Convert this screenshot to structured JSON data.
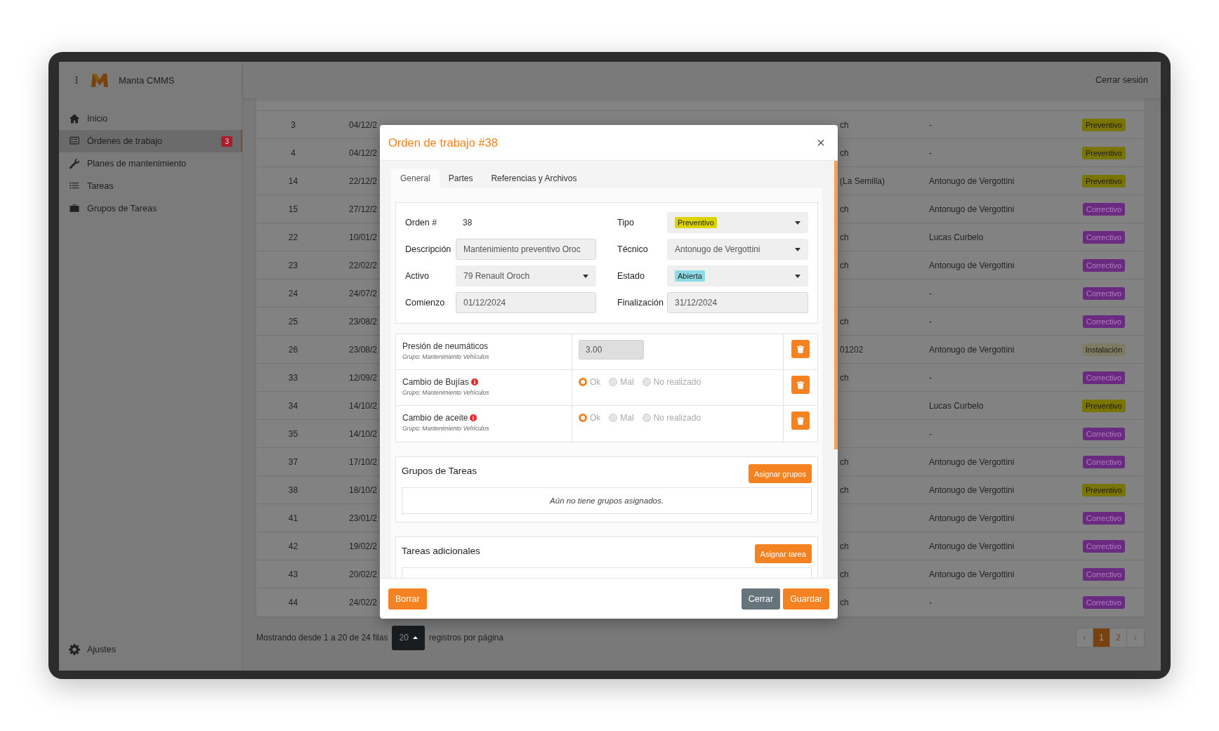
{
  "topbar": {
    "app_name": "Manta CMMS",
    "logout": "Cerrar sesión"
  },
  "sidebar": {
    "items": [
      {
        "label": "Inicio",
        "selected": false
      },
      {
        "label": "Órdenes de trabajo",
        "selected": true,
        "badge": "3"
      },
      {
        "label": "Planes de mantenimiento",
        "selected": false
      },
      {
        "label": "Tareas",
        "selected": false
      },
      {
        "label": "Grupos de Tareas",
        "selected": false
      }
    ],
    "settings": "Ajustes"
  },
  "table": {
    "rows": [
      {
        "id": "3",
        "date": "04/12/2",
        "asset": "ch",
        "technician": "-",
        "type": {
          "label": "Preventivo",
          "color": "#7a7400"
        }
      },
      {
        "id": "4",
        "date": "04/12/2",
        "asset": "ch",
        "technician": "-",
        "type": {
          "label": "Preventivo",
          "color": "#7a7400"
        }
      },
      {
        "id": "14",
        "date": "22/12/2",
        "asset": "(La Semilla)",
        "technician": "Antonugo de Vergottini",
        "type": {
          "label": "Preventivo",
          "color": "#7a7400"
        }
      },
      {
        "id": "15",
        "date": "27/12/2",
        "asset": "ch",
        "technician": "Antonugo de Vergottini",
        "type": {
          "label": "Correctivo",
          "color": "#6a2a80"
        }
      },
      {
        "id": "22",
        "date": "10/01/2",
        "asset": "ch",
        "technician": "Lucas Curbelo",
        "type": {
          "label": "Correctivo",
          "color": "#6a2a80"
        }
      },
      {
        "id": "23",
        "date": "22/02/2",
        "asset": "ch",
        "technician": "Antonugo de Vergottini",
        "type": {
          "label": "Correctivo",
          "color": "#6a2a80"
        }
      },
      {
        "id": "24",
        "date": "24/07/2",
        "technician": "-",
        "type": {
          "label": "Correctivo",
          "color": "#6a2a80"
        }
      },
      {
        "id": "25",
        "date": "23/08/2",
        "asset": "ch",
        "technician": "-",
        "type": {
          "label": "Correctivo",
          "color": "#6a2a80"
        }
      },
      {
        "id": "26",
        "date": "23/08/2",
        "asset": "01202",
        "technician": "Antonugo de Vergottini",
        "type": {
          "label": "Instalación",
          "color": "#807c64"
        }
      },
      {
        "id": "33",
        "date": "12/09/2",
        "asset": "ch",
        "technician": "-",
        "type": {
          "label": "Correctivo",
          "color": "#6a2a80"
        }
      },
      {
        "id": "34",
        "date": "14/10/2",
        "technician": "Lucas Curbelo",
        "type": {
          "label": "Preventivo",
          "color": "#7a7400"
        }
      },
      {
        "id": "35",
        "date": "14/10/2",
        "technician": "-",
        "type": {
          "label": "Correctivo",
          "color": "#6a2a80"
        }
      },
      {
        "id": "37",
        "date": "17/10/2",
        "asset": "ch",
        "technician": "Antonugo de Vergottini",
        "type": {
          "label": "Correctivo",
          "color": "#6a2a80"
        }
      },
      {
        "id": "38",
        "date": "18/10/2",
        "asset": "ch",
        "technician": "Antonugo de Vergottini",
        "type": {
          "label": "Preventivo",
          "color": "#7a7400"
        }
      },
      {
        "id": "41",
        "date": "23/01/2",
        "technician": "Antonugo de Vergottini",
        "type": {
          "label": "Correctivo",
          "color": "#6a2a80"
        }
      },
      {
        "id": "42",
        "date": "19/02/2",
        "asset": "ch",
        "technician": "Antonugo de Vergottini",
        "type": {
          "label": "Correctivo",
          "color": "#6a2a80"
        }
      },
      {
        "id": "43",
        "date": "20/02/2",
        "asset": "ch",
        "technician": "Antonugo de Vergottini",
        "type": {
          "label": "Correctivo",
          "color": "#6a2a80"
        }
      },
      {
        "id": "44",
        "date": "24/02/2",
        "asset": "ch",
        "technician": "-",
        "type": {
          "label": "Correctivo",
          "color": "#6a2a80"
        }
      }
    ]
  },
  "pagination": {
    "summary": "Mostrando desde 1 a 20 de 24 filas",
    "page_size": "20",
    "page_size_label": "registros por página",
    "pages": [
      {
        "label": "‹",
        "selected": false
      },
      {
        "label": "1",
        "selected": true
      },
      {
        "label": "2",
        "selected": false
      },
      {
        "label": "›",
        "selected": false
      }
    ]
  },
  "modal": {
    "title": "Orden de trabajo #38",
    "close": "×",
    "tabs": [
      {
        "label": "General",
        "selected": true
      },
      {
        "label": "Partes",
        "selected": false
      },
      {
        "label": "Referencias y Archivos",
        "selected": false
      }
    ],
    "fields": [
      {
        "label": "Orden #",
        "kind": "text",
        "value": "38"
      },
      {
        "label": "Tipo",
        "kind": "badge-select",
        "value": "Preventivo",
        "color": "#dcd400"
      },
      {
        "label": "Descripción",
        "kind": "input",
        "value": "Mantenimiento preventivo Oroc"
      },
      {
        "label": "Técnico",
        "kind": "select",
        "value": "Antonugo de Vergottini"
      },
      {
        "label": "Activo",
        "kind": "select",
        "value": "79 Renault Oroch"
      },
      {
        "label": "Estado",
        "kind": "badge-select",
        "value": "Abierta",
        "color": "#8ddbe6"
      },
      {
        "label": "Comienzo",
        "kind": "input",
        "value": "01/12/2024"
      },
      {
        "label": "Finalización",
        "kind": "input",
        "value": "31/12/2024"
      }
    ],
    "tasks": [
      {
        "name": "Presión de neumáticos",
        "group": "Grupo: Mantenimiento Vehículos",
        "info": false,
        "kind": "number",
        "value": "3.00"
      },
      {
        "name": "Cambio de Bujías",
        "group": "Grupo: Mantenimiento Vehículos",
        "info": true,
        "kind": "radio",
        "options": [
          {
            "label": "Ok",
            "selected": true
          },
          {
            "label": "Mal",
            "selected": false
          },
          {
            "label": "No realizado",
            "selected": false
          }
        ]
      },
      {
        "name": "Cambio de aceite",
        "group": "Grupo: Mantenimiento Vehículos",
        "info": true,
        "kind": "radio",
        "options": [
          {
            "label": "Ok",
            "selected": true
          },
          {
            "label": "Mal",
            "selected": false
          },
          {
            "label": "No realizado",
            "selected": false
          }
        ]
      }
    ],
    "groups_section": {
      "title": "Grupos de Tareas",
      "button": "Asignar grupos",
      "empty": "Aún no tiene grupos asignados."
    },
    "extra_section": {
      "title": "Tareas adicionales",
      "button": "Asignar tarea"
    },
    "footer": {
      "delete": "Borrar",
      "close": "Cerrar",
      "save": "Guardar"
    }
  }
}
